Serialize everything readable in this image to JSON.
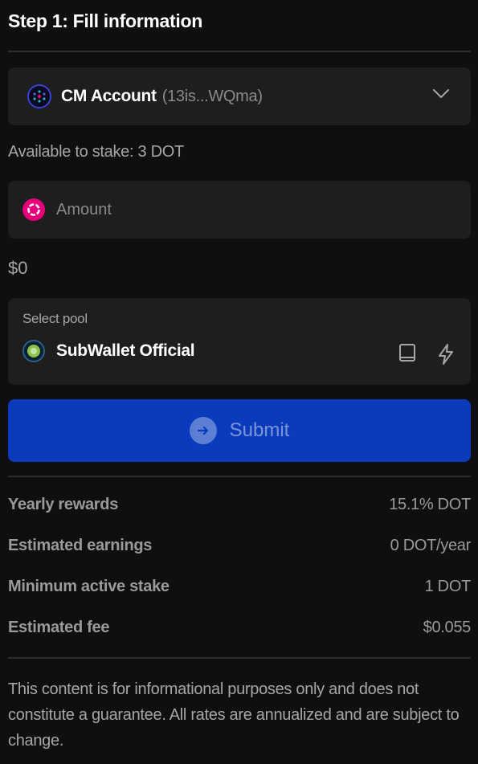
{
  "header": {
    "title": "Step 1: Fill information"
  },
  "account": {
    "name": "CM Account",
    "address": "(13is...WQma)",
    "avatar_icon": "network-avatar-icon",
    "chevron_icon": "chevron-down-icon"
  },
  "available": {
    "text": "Available to stake: 3 DOT"
  },
  "amount": {
    "placeholder": "Amount",
    "value": "",
    "token_icon": "polkadot-icon",
    "usd_value": "$0"
  },
  "pool": {
    "label": "Select pool",
    "name": "SubWallet Official",
    "icons": [
      "book-icon",
      "lightning-icon"
    ]
  },
  "submit": {
    "label": "Submit",
    "icon": "arrow-right-circle-icon"
  },
  "stats": [
    {
      "label": "Yearly rewards",
      "value": "15.1% DOT"
    },
    {
      "label": "Estimated earnings",
      "value": "0 DOT/year"
    },
    {
      "label": "Minimum active stake",
      "value": "1 DOT"
    },
    {
      "label": "Estimated fee",
      "value": "$0.055"
    }
  ],
  "disclaimer": "This content is for informational purposes only and does not constitute a guarantee. All rates are annualized and are subject to change.",
  "colors": {
    "background": "#0f0f0f",
    "card": "#1e1e1e",
    "primary_button": "#0a3bbd",
    "polkadot_pink": "#e6007a"
  }
}
